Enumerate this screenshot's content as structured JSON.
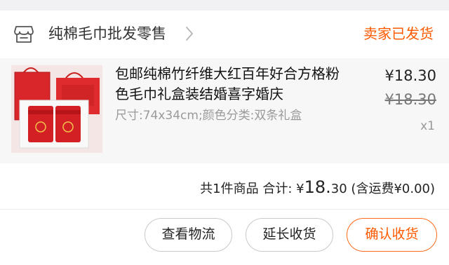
{
  "shop": {
    "name": "纯棉毛巾批发零售",
    "icon": "store-icon",
    "status": "卖家已发货",
    "status_color": "#ff5a00"
  },
  "product": {
    "title": "包邮纯棉竹纤维大红百年好合方格粉色毛巾礼盒装结婚喜字婚庆",
    "specs": "尺寸:74x34cm;颜色分类:双条礼盒",
    "price": "¥18.30",
    "original_price": "¥18.30",
    "quantity": "x1",
    "thumbnail": "red-towel-gift-box-image"
  },
  "summary": {
    "count_text": "共1件商品 合计:",
    "currency": "¥",
    "total_int": "18.",
    "total_dec": "30",
    "shipping_note": "(含运费¥0.00)"
  },
  "actions": {
    "logistics": "查看物流",
    "extend": "延长收货",
    "confirm": "确认收货",
    "confirm_color": "#ff5a00"
  }
}
